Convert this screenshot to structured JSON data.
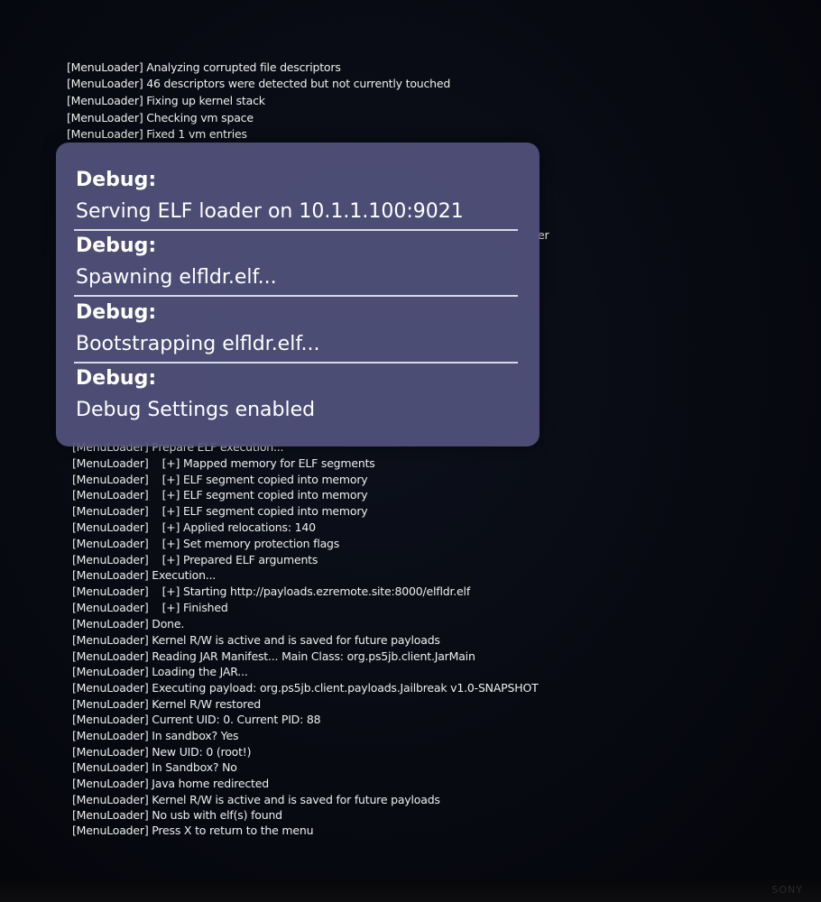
{
  "console": {
    "lines_above": [
      "[MenuLoader] Analyzing corrupted file descriptors",
      "[MenuLoader] 46 descriptors were detected but not currently touched",
      "[MenuLoader] Fixing up kernel stack",
      "[MenuLoader] Checking vm space",
      "[MenuLoader] Fixed 1 vm entries"
    ],
    "partial_line_fragment": "er",
    "lines_below": [
      "[MenuLoader] Prepare ELF execution...",
      "[MenuLoader]    [+] Mapped memory for ELF segments",
      "[MenuLoader]    [+] ELF segment copied into memory",
      "[MenuLoader]    [+] ELF segment copied into memory",
      "[MenuLoader]    [+] ELF segment copied into memory",
      "[MenuLoader]    [+] Applied relocations: 140",
      "[MenuLoader]    [+] Set memory protection flags",
      "[MenuLoader]    [+] Prepared ELF arguments",
      "[MenuLoader] Execution...",
      "[MenuLoader]    [+] Starting http://payloads.ezremote.site:8000/elfldr.elf",
      "[MenuLoader]    [+] Finished",
      "[MenuLoader] Done.",
      "[MenuLoader] Kernel R/W is active and is saved for future payloads",
      "[MenuLoader] Reading JAR Manifest... Main Class: org.ps5jb.client.JarMain",
      "[MenuLoader] Loading the JAR...",
      "[MenuLoader] Executing payload: org.ps5jb.client.payloads.Jailbreak v1.0-SNAPSHOT",
      "[MenuLoader] Kernel R/W restored",
      "[MenuLoader] Current UID: 0. Current PID: 88",
      "[MenuLoader] In sandbox? Yes",
      "[MenuLoader] New UID: 0 (root!)",
      "[MenuLoader] In Sandbox? No",
      "[MenuLoader] Java home redirected",
      "[MenuLoader] Kernel R/W is active and is saved for future payloads",
      "[MenuLoader] No usb with elf(s) found",
      "[MenuLoader] Press X to return to the menu"
    ]
  },
  "notifications": [
    {
      "title": "Debug:",
      "message": "Serving ELF loader on 10.1.1.100:9021"
    },
    {
      "title": "Debug:",
      "message": "Spawning elfldr.elf..."
    },
    {
      "title": "Debug:",
      "message": "Bootstrapping elfldr.elf..."
    },
    {
      "title": "Debug:",
      "message": "Debug Settings enabled"
    }
  ],
  "bezel": {
    "brand": "SONY"
  },
  "colors": {
    "background": "#080a12",
    "console_text": "#eeeeee",
    "panel": "#52527c",
    "panel_text": "#ffffff",
    "divider": "#d8d8e6"
  }
}
